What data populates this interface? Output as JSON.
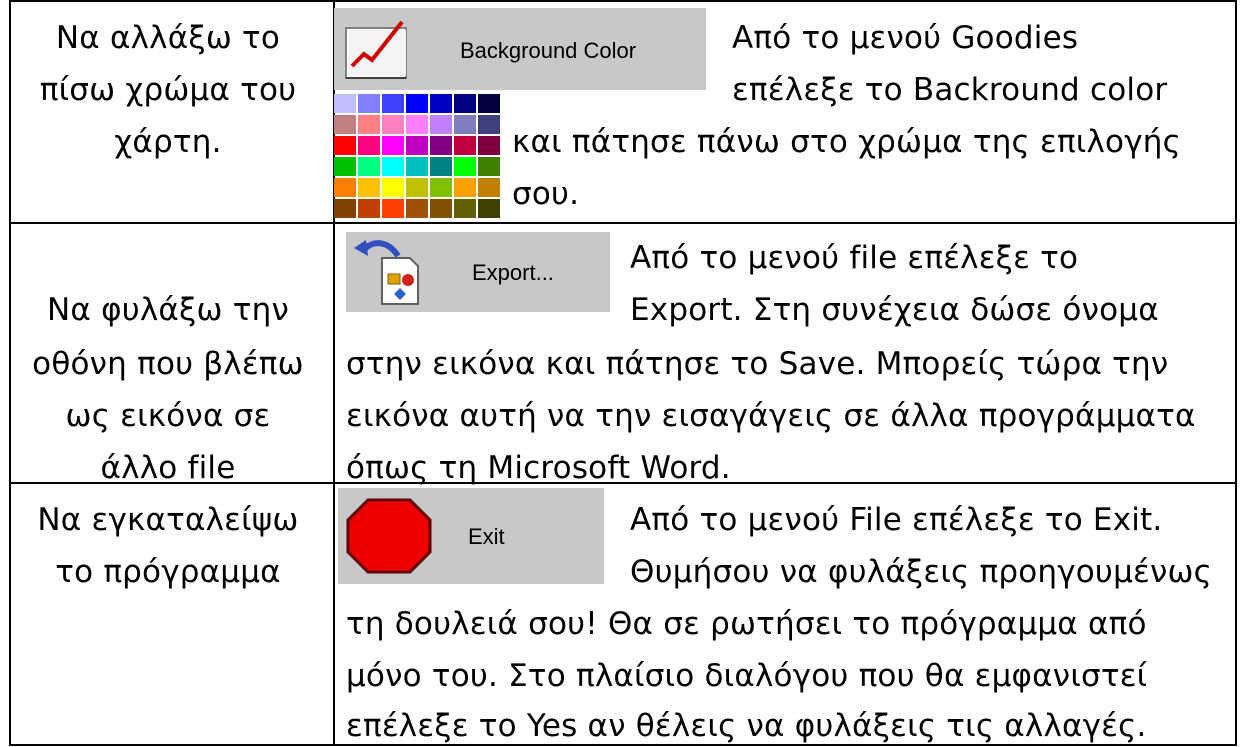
{
  "rows": [
    {
      "task": [
        "Να αλλάξω το",
        "πίσω χρώμα του",
        "χάρτη."
      ],
      "button_label": "Background Color",
      "text": [
        "Από το μενού Goodies",
        "επέλεξε το Backround color",
        "και πάτησε πάνω στο χρώμα της επιλογής",
        "σου."
      ],
      "palette_colors": [
        "#c0c0ff",
        "#8080ff",
        "#4040ff",
        "#0000ff",
        "#0000c0",
        "#000080",
        "#000040",
        "#c08080",
        "#ff8080",
        "#ff80c0",
        "#ff80ff",
        "#c080ff",
        "#8080c0",
        "#404080",
        "#ff0000",
        "#ff0080",
        "#ff00ff",
        "#c000c0",
        "#800080",
        "#c00040",
        "#800040",
        "#00c000",
        "#00ff80",
        "#00ffff",
        "#00c0c0",
        "#008080",
        "#00ff00",
        "#408000",
        "#ff8000",
        "#ffc000",
        "#ffff00",
        "#c0c000",
        "#80c000",
        "#ffa000",
        "#c08000",
        "#804000",
        "#c04000",
        "#ff4000",
        "#a05000",
        "#805000",
        "#606000",
        "#404000"
      ]
    },
    {
      "task": [
        "Να φυλάξω την",
        "οθόνη που βλέπω",
        "ως εικόνα σε",
        "άλλο file"
      ],
      "button_label": "Export...",
      "text": [
        "Από το μενού  file επέλεξε το",
        "Export. Στη συνέχεια δώσε όνομα",
        "στην εικόνα και πάτησε το Save. Μπορείς τώρα την",
        "εικόνα αυτή να την εισαγάγεις σε άλλα προγράμματα",
        "όπως τη Microsoft Word."
      ]
    },
    {
      "task": [
        "Να εγκαταλείψω",
        "το πρόγραμμα"
      ],
      "button_label": "Exit",
      "text": [
        "Από το μενού File επέλεξε το Exit.",
        "Θυμήσου να φυλάξεις προηγουμένως",
        "τη δουλειά σου! Θα σε ρωτήσει το πρόγραμμα από",
        "μόνο του. Στο πλαίσιο διαλόγου που θα εμφανιστεί",
        "επέλεξε το Yes αν θέλεις να φυλάξεις τις αλλαγές."
      ]
    }
  ]
}
